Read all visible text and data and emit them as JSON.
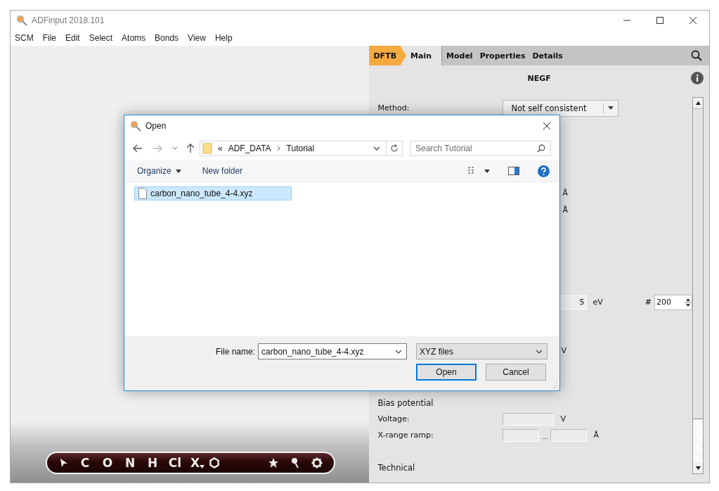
{
  "window": {
    "title": "ADFinput 2018.101"
  },
  "menu": [
    "SCM",
    "File",
    "Edit",
    "Select",
    "Atoms",
    "Bonds",
    "View",
    "Help"
  ],
  "breadcrumb": "DFTB",
  "tabs": [
    {
      "label": "Main",
      "selected": true
    },
    {
      "label": "Model",
      "selected": false
    },
    {
      "label": "Properties",
      "selected": false
    },
    {
      "label": "Details",
      "selected": false
    }
  ],
  "panel": {
    "title": "NEGF",
    "rows": [
      {
        "kind": "select",
        "label": "Method:",
        "value": "Not self consistent"
      },
      {
        "kind": "unit",
        "unit": "Å"
      },
      {
        "kind": "unit",
        "unit": "Å"
      },
      {
        "kind": "range",
        "value": "5",
        "unit": "eV",
        "count_label": "#",
        "count": "200"
      },
      {
        "kind": "unit",
        "unit": "V"
      },
      {
        "kind": "heading",
        "label": "Bias potential"
      },
      {
        "kind": "field",
        "label": "Voltage:",
        "unit": "V"
      },
      {
        "kind": "pair",
        "label": "X-range ramp:",
        "separator": "...",
        "unit": "Å"
      },
      {
        "kind": "heading",
        "label": "Technical"
      }
    ]
  },
  "toolbar": {
    "elements": [
      {
        "symbol": "C",
        "menu": false
      },
      {
        "symbol": "O",
        "menu": false
      },
      {
        "symbol": "N",
        "menu": false
      },
      {
        "symbol": "H",
        "menu": false
      },
      {
        "symbol": "Cl",
        "menu": false
      },
      {
        "symbol": "X",
        "menu": true
      }
    ]
  },
  "dialog": {
    "title": "Open",
    "overflow": "«",
    "path": [
      "ADF_DATA",
      "Tutorial"
    ],
    "search": {
      "placeholder": "Search Tutorial"
    },
    "commands": [
      {
        "label": "Organize",
        "menu": true
      },
      {
        "label": "New folder",
        "menu": false
      }
    ],
    "files": [
      {
        "name": "carbon_nano_tube_4-4.xyz",
        "selected": true
      }
    ],
    "file_name_label": "File name:",
    "file_name": "carbon_nano_tube_4-4.xyz",
    "file_type": "XYZ files",
    "buttons": [
      {
        "label": "Open",
        "default": true
      },
      {
        "label": "Cancel",
        "default": false
      }
    ]
  }
}
